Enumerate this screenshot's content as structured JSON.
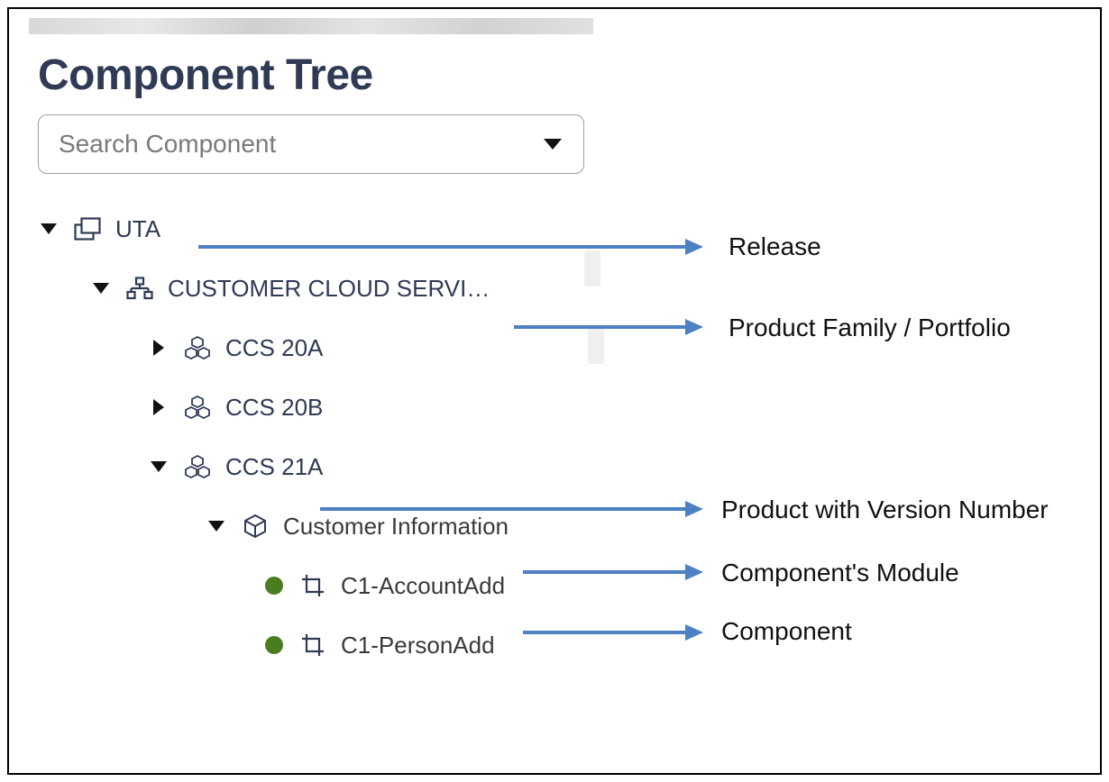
{
  "title": "Component Tree",
  "search": {
    "placeholder": "Search Component"
  },
  "tree": {
    "root": {
      "label": "UTA"
    },
    "family": {
      "label": "CUSTOMER CLOUD SERVI…"
    },
    "products": {
      "p1": {
        "label": "CCS 20A"
      },
      "p2": {
        "label": "CCS 20B"
      },
      "p3": {
        "label": "CCS 21A"
      }
    },
    "module": {
      "label": "Customer Information"
    },
    "components": {
      "c1": {
        "label": "C1-AccountAdd"
      },
      "c2": {
        "label": "C1-PersonAdd"
      }
    }
  },
  "annotations": {
    "release": "Release",
    "family": "Product Family / Portfolio",
    "product_version": "Product with Version Number",
    "module": "Component's Module",
    "component": "Component"
  }
}
